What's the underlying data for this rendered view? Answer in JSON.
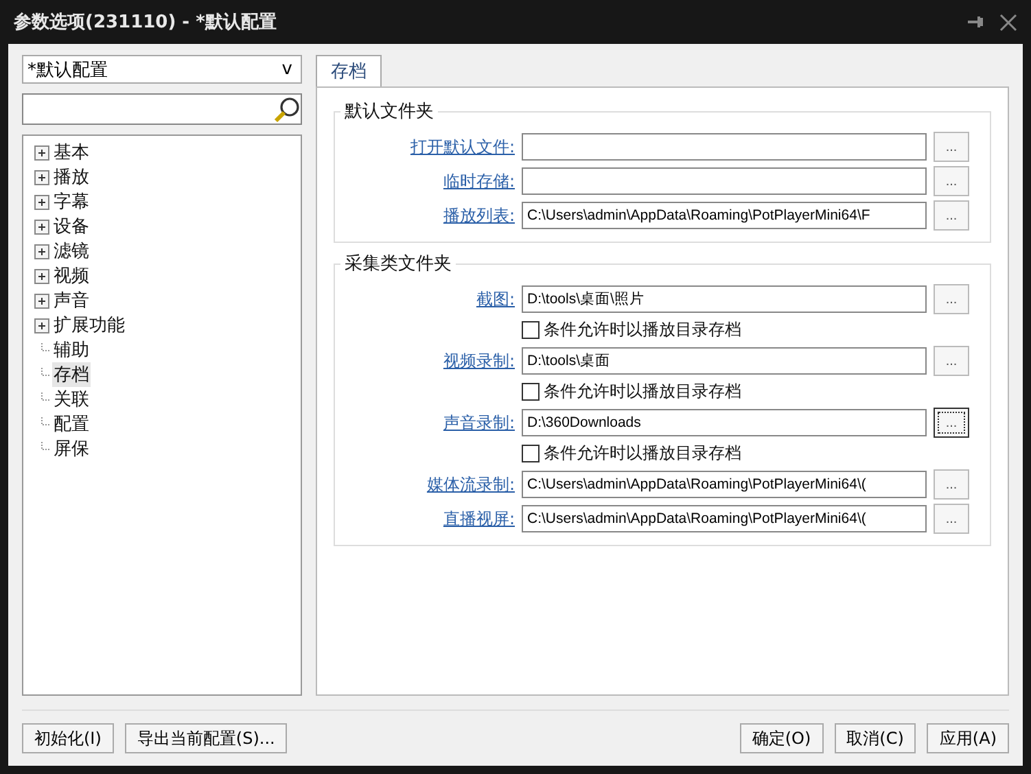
{
  "window": {
    "title": "参数选项(231110) - *默认配置"
  },
  "profile_select": {
    "value": "*默认配置",
    "arrow": "v"
  },
  "tree": [
    {
      "label": "基本",
      "expandable": true,
      "selected": false
    },
    {
      "label": "播放",
      "expandable": true,
      "selected": false
    },
    {
      "label": "字幕",
      "expandable": true,
      "selected": false
    },
    {
      "label": "设备",
      "expandable": true,
      "selected": false
    },
    {
      "label": "滤镜",
      "expandable": true,
      "selected": false
    },
    {
      "label": "视频",
      "expandable": true,
      "selected": false
    },
    {
      "label": "声音",
      "expandable": true,
      "selected": false
    },
    {
      "label": "扩展功能",
      "expandable": true,
      "selected": false
    },
    {
      "label": "辅助",
      "expandable": false,
      "selected": false
    },
    {
      "label": "存档",
      "expandable": false,
      "selected": true
    },
    {
      "label": "关联",
      "expandable": false,
      "selected": false
    },
    {
      "label": "配置",
      "expandable": false,
      "selected": false
    },
    {
      "label": "屏保",
      "expandable": false,
      "selected": false
    }
  ],
  "tabs": [
    {
      "label": "存档",
      "selected": true
    }
  ],
  "groups": [
    {
      "title": "默认文件夹",
      "rows": [
        {
          "label": "打开默认文件:",
          "value": "",
          "browse": "...",
          "focused": false
        },
        {
          "label": "临时存储:",
          "value": "",
          "browse": "...",
          "focused": false
        },
        {
          "label": "播放列表:",
          "value": "C:\\Users\\admin\\AppData\\Roaming\\PotPlayerMini64\\F",
          "browse": "...",
          "focused": false
        }
      ]
    },
    {
      "title": "采集类文件夹",
      "rows": [
        {
          "label": "截图:",
          "value": "D:\\tools\\桌面\\照片",
          "browse": "...",
          "focused": false,
          "option": {
            "label": "条件允许时以播放目录存档",
            "checked": false
          }
        },
        {
          "label": "视频录制:",
          "value": "D:\\tools\\桌面",
          "browse": "...",
          "focused": false,
          "option": {
            "label": "条件允许时以播放目录存档",
            "checked": false
          }
        },
        {
          "label": "声音录制:",
          "value": "D:\\360Downloads",
          "browse": "...",
          "focused": true,
          "option": {
            "label": "条件允许时以播放目录存档",
            "checked": false
          }
        },
        {
          "label": "媒体流录制:",
          "value": "C:\\Users\\admin\\AppData\\Roaming\\PotPlayerMini64\\(",
          "browse": "...",
          "focused": false
        },
        {
          "label": "直播视屏:",
          "value": "C:\\Users\\admin\\AppData\\Roaming\\PotPlayerMini64\\(",
          "browse": "...",
          "focused": false
        }
      ]
    }
  ],
  "footer_left": [
    "初始化(I)",
    "导出当前配置(S)..."
  ],
  "footer_right": [
    "确定(O)",
    "取消(C)",
    "应用(A)"
  ]
}
